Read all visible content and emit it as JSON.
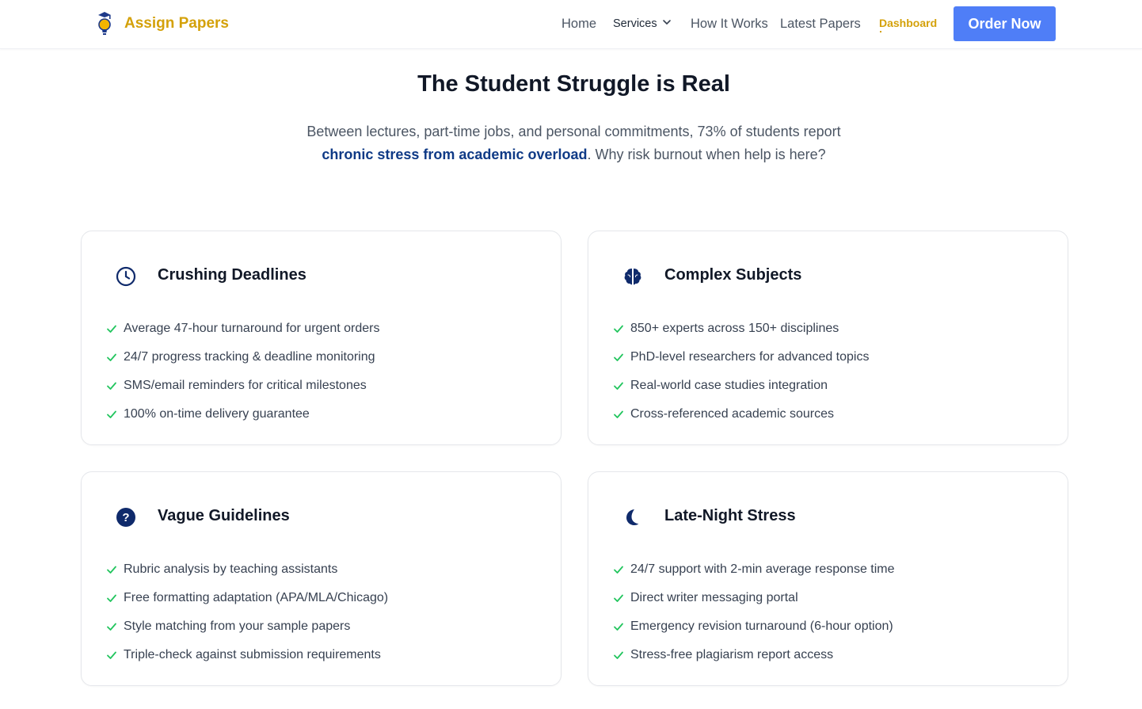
{
  "brand": {
    "name": "Assign Papers",
    "accent": "#d4a10a",
    "icon": "lightbulb-graduation-icon"
  },
  "nav": {
    "home": "Home",
    "services": "Services",
    "how_it_works": "How It Works",
    "latest_papers": "Latest Papers",
    "dashboard": "Dashboard",
    "order_now": "Order Now"
  },
  "colors": {
    "primary_button": "#4f7ef7",
    "heading": "#111827",
    "highlight": "#0f3a86",
    "check": "#22c55e",
    "icon": "#0f2a6b"
  },
  "hero": {
    "title": "The Student Struggle is Real",
    "subtitle_part1": "Between lectures, part-time jobs, and personal commitments, 73% of students report",
    "subtitle_highlight": "chronic stress from academic overload",
    "subtitle_part2": ". Why risk burnout when help is here?"
  },
  "cards": [
    {
      "icon": "clock-icon",
      "title": "Crushing Deadlines",
      "items": [
        "Average 47-hour turnaround for urgent orders",
        "24/7 progress tracking & deadline monitoring",
        "SMS/email reminders for critical milestones",
        "100% on-time delivery guarantee"
      ]
    },
    {
      "icon": "brain-icon",
      "title": "Complex Subjects",
      "items": [
        "850+ experts across 150+ disciplines",
        "PhD-level researchers for advanced topics",
        "Real-world case studies integration",
        "Cross-referenced academic sources"
      ]
    },
    {
      "icon": "question-circle-icon",
      "title": "Vague Guidelines",
      "items": [
        "Rubric analysis by teaching assistants",
        "Free formatting adaptation (APA/MLA/Chicago)",
        "Style matching from your sample papers",
        "Triple-check against submission requirements"
      ]
    },
    {
      "icon": "moon-icon",
      "title": "Late-Night Stress",
      "items": [
        "24/7 support with 2-min average response time",
        "Direct writer messaging portal",
        "Emergency revision turnaround (6-hour option)",
        "Stress-free plagiarism report access"
      ]
    }
  ]
}
